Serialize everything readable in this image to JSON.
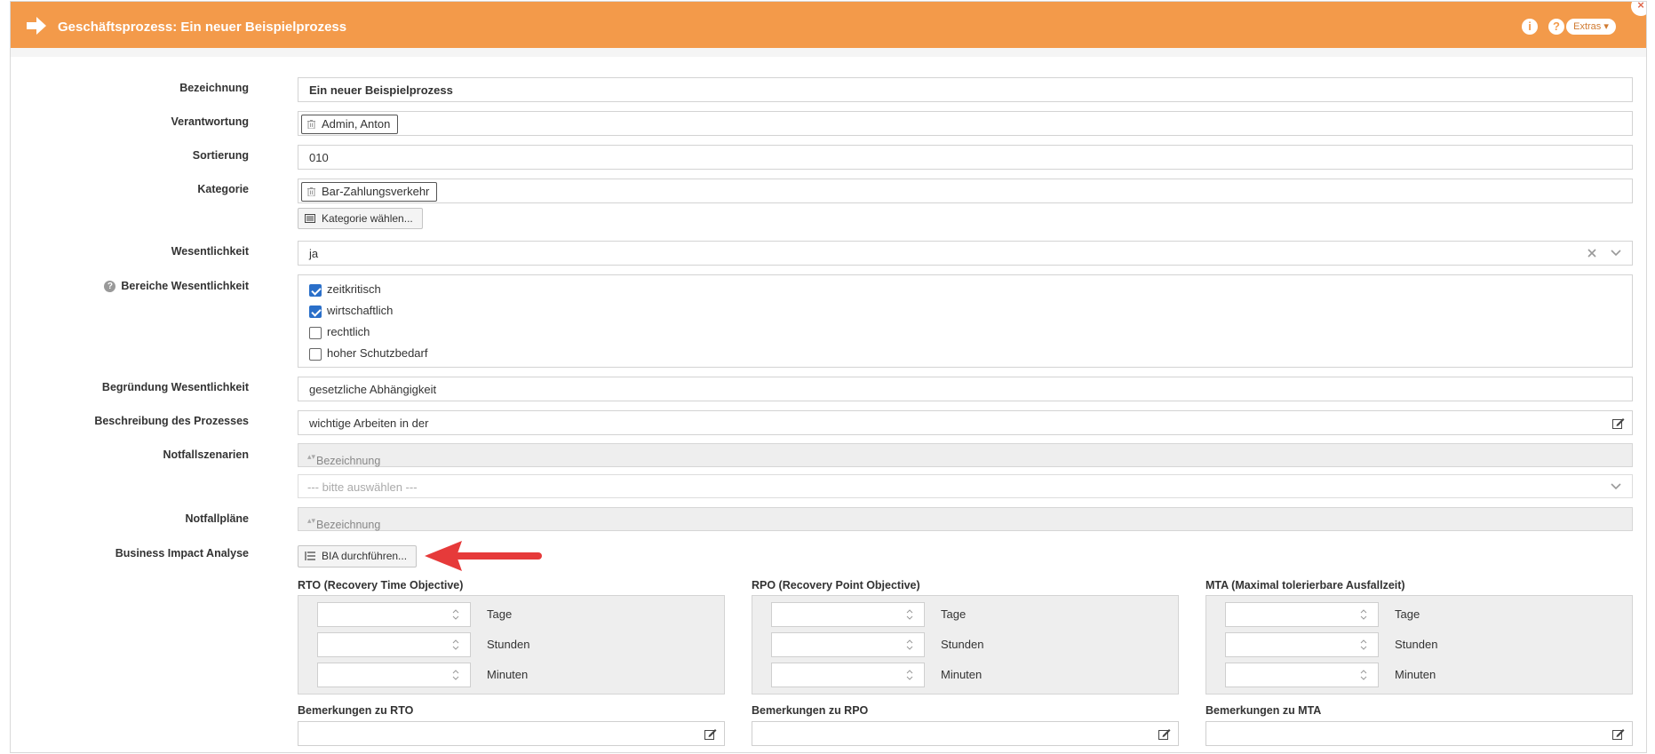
{
  "header": {
    "title": "Geschäftsprozess: Ein neuer Beispielprozess",
    "info_icon": "i",
    "help_icon": "?",
    "extras_label": "Extras",
    "close_icon": "×",
    "bg_color": "#f39a4a"
  },
  "form": {
    "bezeichnung": {
      "label": "Bezeichnung",
      "value": "Ein neuer Beispielprozess"
    },
    "verantwortung": {
      "label": "Verantwortung",
      "tag": "Admin, Anton"
    },
    "sortierung": {
      "label": "Sortierung",
      "value": "010"
    },
    "kategorie": {
      "label": "Kategorie",
      "tag": "Bar-Zahlungsverkehr",
      "button": "Kategorie wählen..."
    },
    "wesentlichkeit": {
      "label": "Wesentlichkeit",
      "value": "ja"
    },
    "bereiche": {
      "label": "Bereiche Wesentlichkeit",
      "options": [
        {
          "label": "zeitkritisch",
          "checked": true
        },
        {
          "label": "wirtschaftlich",
          "checked": true
        },
        {
          "label": "rechtlich",
          "checked": false
        },
        {
          "label": "hoher Schutzbedarf",
          "checked": false
        }
      ]
    },
    "begruendung": {
      "label": "Begründung Wesentlichkeit",
      "value": "gesetzliche Abhängigkeit"
    },
    "beschreibung": {
      "label": "Beschreibung des Prozesses",
      "value": "wichtige Arbeiten in der"
    },
    "notfallszenarien": {
      "label": "Notfallszenarien",
      "column": "Bezeichnung",
      "select_placeholder": "--- bitte auswählen ---"
    },
    "notfallplaene": {
      "label": "Notfallpläne",
      "column": "Bezeichnung"
    },
    "bia": {
      "label": "Business Impact Analyse",
      "button": "BIA durchführen..."
    }
  },
  "objectives": [
    {
      "title": "RTO (Recovery Time Objective)",
      "units": [
        "Tage",
        "Stunden",
        "Minuten"
      ],
      "remark_label": "Bemerkungen zu RTO"
    },
    {
      "title": "RPO (Recovery Point Objective)",
      "units": [
        "Tage",
        "Stunden",
        "Minuten"
      ],
      "remark_label": "Bemerkungen zu RPO"
    },
    {
      "title": "MTA (Maximal tolerierbare Ausfallzeit)",
      "units": [
        "Tage",
        "Stunden",
        "Minuten"
      ],
      "remark_label": "Bemerkungen zu MTA"
    }
  ]
}
